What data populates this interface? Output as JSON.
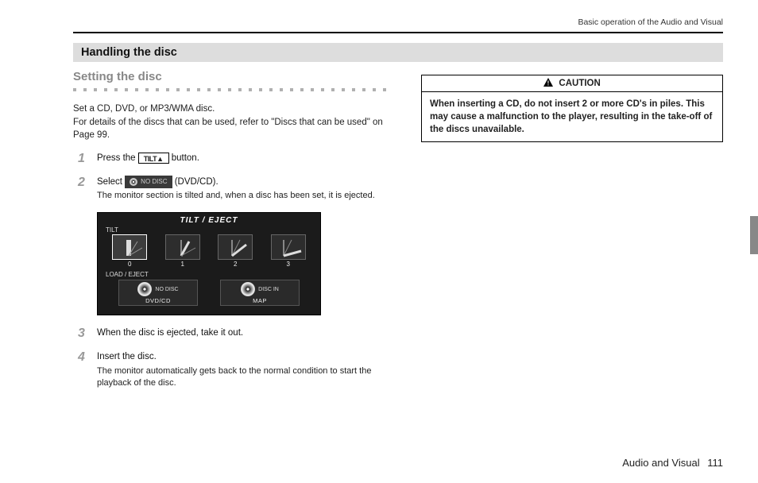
{
  "header": {
    "running": "Basic operation of the Audio and Visual"
  },
  "section": {
    "title": "Handling the disc"
  },
  "subsection": {
    "title": "Setting the disc"
  },
  "intro": {
    "line1": "Set a CD, DVD, or MP3/WMA disc.",
    "line2": "For details of the discs that can be used, refer to \"Discs that can be used\" on Page 99."
  },
  "steps": [
    {
      "num": "1",
      "pre": "Press the ",
      "button_label": "TILT▲",
      "post": " button."
    },
    {
      "num": "2",
      "pre": "Select ",
      "button_label": "NO DISC",
      "post": " (DVD/CD).",
      "note": "The monitor section is tilted and, when a disc has been set, it is ejected."
    },
    {
      "num": "3",
      "main": "When the disc is ejected, take it out."
    },
    {
      "num": "4",
      "main": "Insert the disc.",
      "note": "The monitor automatically gets back to the normal condition to start the playback of the disc."
    }
  ],
  "screenshot": {
    "title": "TILT / EJECT",
    "tilt_label": "TILT",
    "tilt_values": [
      "0",
      "1",
      "2",
      "3"
    ],
    "load_label": "LOAD / EJECT",
    "slots": [
      {
        "status": "NO DISC",
        "caption": "DVD/CD"
      },
      {
        "status": "DISC IN",
        "caption": "MAP"
      }
    ]
  },
  "caution": {
    "header": "CAUTION",
    "body": "When inserting a CD, do not insert 2 or more CD's in piles. This may cause a malfunction to the player, resulting in the take-off of the discs unavailable."
  },
  "footer": {
    "section": "Audio and Visual",
    "page": "111"
  }
}
